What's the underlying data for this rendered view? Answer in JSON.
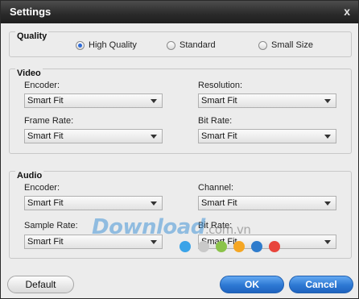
{
  "window": {
    "title": "Settings",
    "close_label": "x"
  },
  "quality": {
    "title": "Quality",
    "options": [
      {
        "label": "High Quality",
        "checked": true
      },
      {
        "label": "Standard",
        "checked": false
      },
      {
        "label": "Small Size",
        "checked": false
      }
    ]
  },
  "video": {
    "title": "Video",
    "encoder": {
      "label": "Encoder:",
      "value": "Smart Fit"
    },
    "resolution": {
      "label": "Resolution:",
      "value": "Smart Fit"
    },
    "frame_rate": {
      "label": "Frame Rate:",
      "value": "Smart Fit"
    },
    "bit_rate": {
      "label": "Bit Rate:",
      "value": "Smart Fit"
    }
  },
  "audio": {
    "title": "Audio",
    "encoder": {
      "label": "Encoder:",
      "value": "Smart Fit"
    },
    "channel": {
      "label": "Channel:",
      "value": "Smart Fit"
    },
    "sample_rate": {
      "label": "Sample Rate:",
      "value": "Smart Fit"
    },
    "bit_rate": {
      "label": "Bit Rate:",
      "value": "Smart Fit"
    }
  },
  "buttons": {
    "default": "Default",
    "ok": "OK",
    "cancel": "Cancel"
  },
  "watermark": {
    "main": "Download",
    "tld": ".com.vn"
  },
  "colors": {
    "accent": "#2d78d3",
    "watermark_dots": [
      "#3aa3e8",
      "#c9c9c9",
      "#8bc34a",
      "#f5a623",
      "#2f7ccc",
      "#e8453c"
    ]
  }
}
